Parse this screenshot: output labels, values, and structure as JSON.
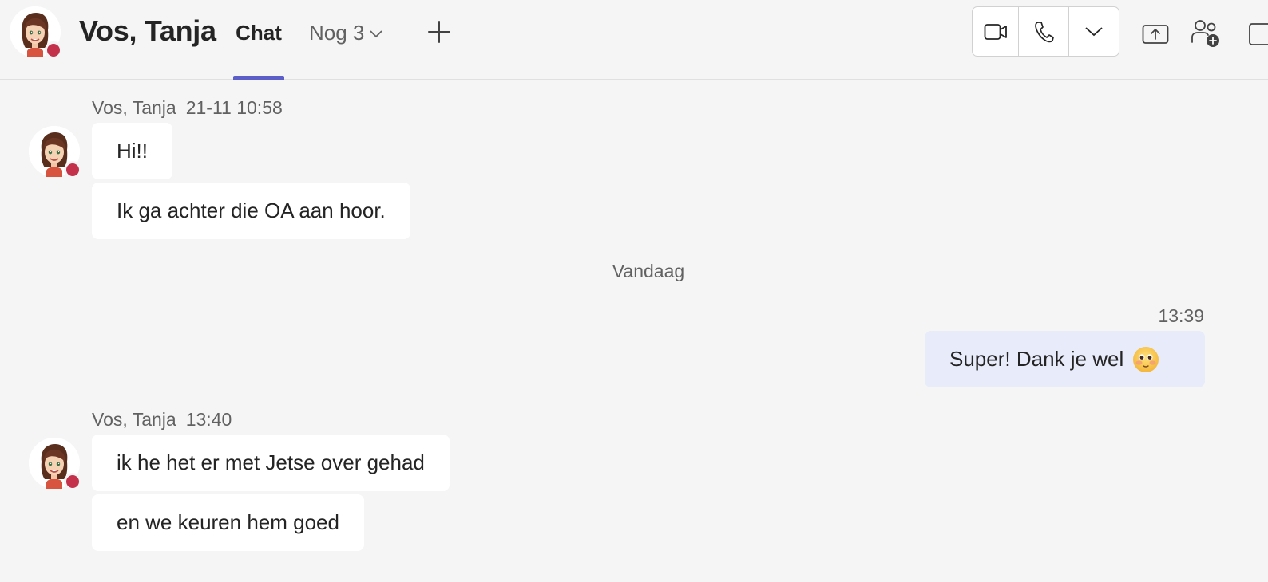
{
  "header": {
    "contact_name": "Vos, Tanja",
    "tab_chat": "Chat",
    "tab_more": "Nog 3",
    "icons": [
      "avatar",
      "chevron-down-icon",
      "plus-icon",
      "video-call-icon",
      "phone-icon",
      "chevron-down-icon",
      "share-screen-icon",
      "add-people-icon"
    ]
  },
  "colors": {
    "accent": "#5b5fc7",
    "presence_busy": "#c4314b",
    "self_bubble": "#e8ebfa",
    "background": "#f5f5f5"
  },
  "messages": {
    "group1": {
      "sender": "Vos, Tanja",
      "time": "21-11 10:58",
      "texts": [
        "Hi!!",
        "Ik ga achter die OA aan hoor."
      ]
    },
    "day_separator": "Vandaag",
    "self": {
      "time": "13:39",
      "text": "Super! Dank je wel",
      "emoji": "blushing-face-emoji"
    },
    "group2": {
      "sender": "Vos, Tanja",
      "time": "13:40",
      "texts": [
        "ik he het er met Jetse over gehad",
        "en we keuren hem goed"
      ]
    }
  }
}
